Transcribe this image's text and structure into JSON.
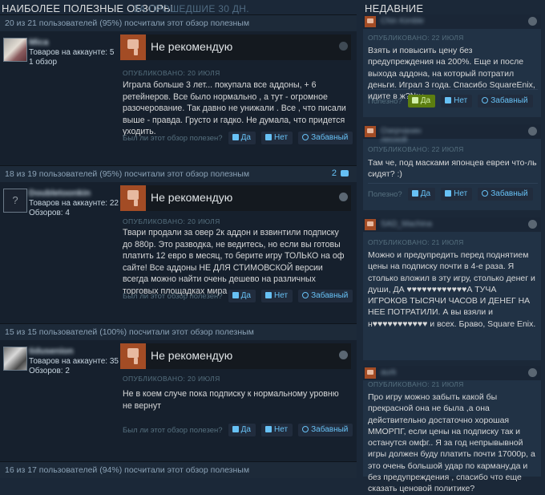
{
  "header": {
    "title": "НАИБОЛЕЕ ПОЛЕЗНЫЕ ОБЗОРЫ",
    "subtitle": "ЗА ПРОШЕДШИЕ 30 ДН.",
    "recent_title": "НЕДАВНИЕ"
  },
  "labels": {
    "helpful_question": "Был ли этот обзор полезен?",
    "helpful_short": "Полезно?",
    "yes": "Да",
    "no": "Нет",
    "funny": "Забавный"
  },
  "reviews": [
    {
      "helpful": "20 из 21 пользователей (95%) посчитали этот обзор полезным",
      "author_name": "Mica",
      "products": "Товаров на аккаунте: 5",
      "reviews_count": "1 обзор",
      "recommendation": "Не рекомендую",
      "posted": "ОПУБЛИКОВАНО: 20 ИЮЛЯ",
      "text": "Играла больше 3 лет... покупала все аддоны, + 6 ретейнеров. Все было нормально , а тут - огромное разочерование. Так давно не унижали . Все , что писали выше - правда. Грусто и гадко. Не думала, что придется уходить."
    },
    {
      "helpful": "18 из 19 пользователей (95%) посчитали этот обзор полезным",
      "comments": "2",
      "author_name": "Doubletoonkin",
      "products": "Товаров на аккаунте: 22",
      "reviews_count": "Обзоров: 4",
      "recommendation": "Не рекомендую",
      "posted": "ОПУБЛИКОВАНО: 20 ИЮЛЯ",
      "text": "Твари продали за овер 2к аддон и взвинтили подписку до 880р. Это разводка, не ведитесь, но если вы готовы платить 12 евро в месяц, то берите игру ТОЛЬКО на оф сайте! Все аддоны НЕ ДЛЯ СТИМОВСКОЙ версии всегда можно найти очень дешево на различных торговых площадках мира"
    },
    {
      "helpful": "15 из 15 пользователей (100%) посчитали этот обзор полезным",
      "author_name": "tidusenion",
      "products": "Товаров на аккаунте: 35",
      "reviews_count": "Обзоров: 2",
      "recommendation": "Не рекомендую",
      "posted": "ОПУБЛИКОВАНО: 20 ИЮЛЯ",
      "text": "Не в коем случе пока подписку к нормальному уровню не вернут"
    },
    {
      "helpful": "16 из 17 пользователей (94%) посчитали этот обзор полезным"
    }
  ],
  "recent": [
    {
      "author_name": "Chin Kimble",
      "posted": "ОПУБЛИКОВАНО: 22 ИЮЛЯ",
      "text": "Взять и повысить цену без предупреждения на 200%. Еще и после выхода аддона, на который потратил деньги. Играл 3 года. Спасибо SquareEnix, идите в ж?№у."
    },
    {
      "author_name": "Озерчанин лесной",
      "posted": "ОПУБЛИКОВАНО: 22 ИЮЛЯ",
      "text": "Там че, под масками японцев евреи что-ль сидят? :)"
    },
    {
      "author_name": "SAD_Machina",
      "posted": "ОПУБЛИКОВАНО: 21 ИЮЛЯ",
      "text": "Можно и предупредить перед поднятием цены на подписку почти в 4-е раза. Я столько вложил в эту игру, столько денег и души, ДА ♥♥♥♥♥♥♥♥♥♥♥♥А ТУЧА ИГРОКОВ ТЫСЯЧИ ЧАСОВ И ДЕНЕГ НА НЕЕ ПОТРАТИЛИ. А вы взяли и н♥♥♥♥♥♥♥♥♥♥♥ и всех. Браво, Square Enix."
    },
    {
      "author_name": "aurk",
      "posted": "ОПУБЛИКОВАНО: 21 ИЮЛЯ",
      "text": "Про игру можно забыть какой бы прекрасной она не была ,а она действительно достаточно хорошая ММОРПГ, если цены на подписку так и останутся омфг.. Я за год непрывывной игры должен буду платить почти 17000р, а это очень большой удар по карману,да и без предупреждения , спасибо что еще сказать ценовой политике?"
    }
  ],
  "colors": {
    "background": "#1b2838",
    "accent_blue": "#67c1f5",
    "thumb_down": "#a34c25",
    "active_yes": "#5c7e10"
  }
}
